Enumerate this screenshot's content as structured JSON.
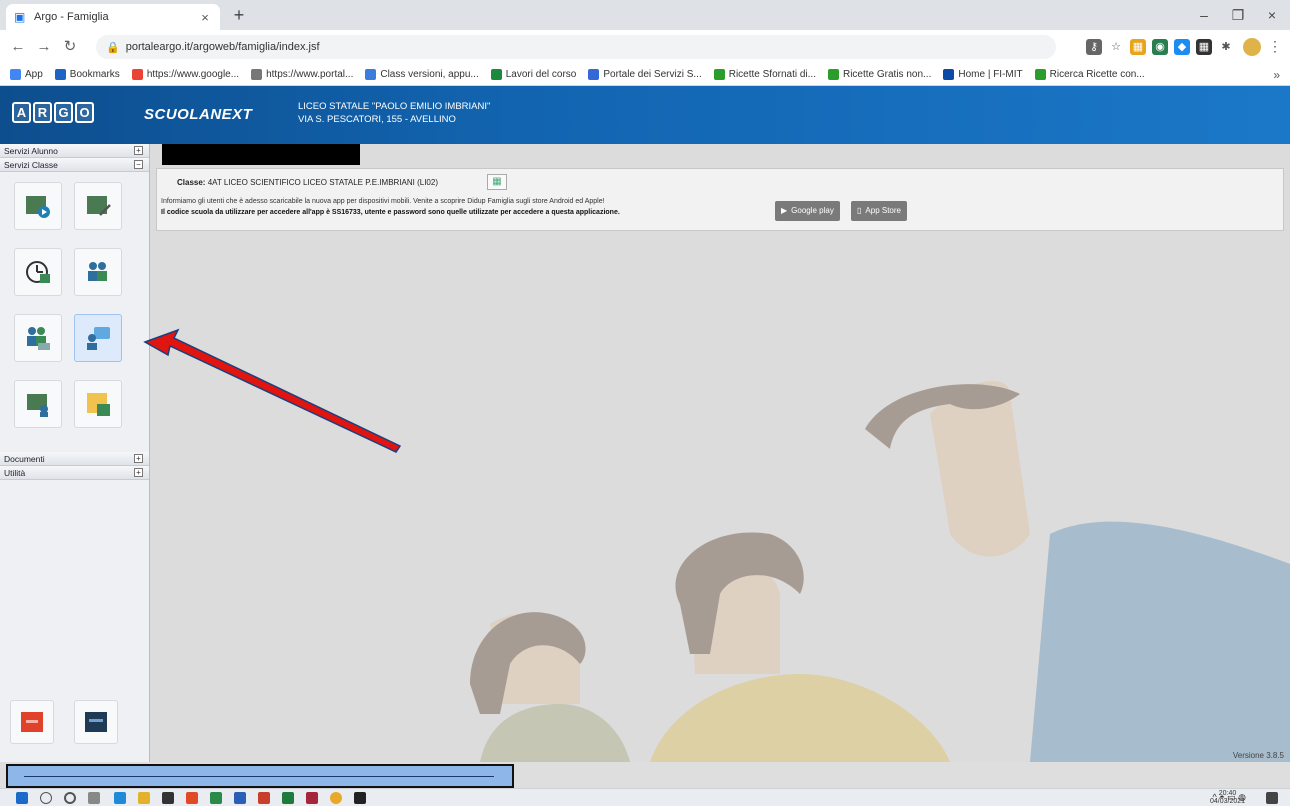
{
  "browser": {
    "tab_title": "Argo - Famiglia",
    "url": "portaleargo.it/argoweb/famiglia/index.jsf",
    "bookmarks": [
      {
        "label": "App",
        "color": "#4285f4"
      },
      {
        "label": "Bookmarks",
        "color": "#1e63c6"
      },
      {
        "label": "https://www.google...",
        "color": "#ea4335"
      },
      {
        "label": "https://www.portal...",
        "color": "#777777"
      },
      {
        "label": "Class versioni, appu...",
        "color": "#3b7ddd"
      },
      {
        "label": "Lavori del corso",
        "color": "#1b8a3e"
      },
      {
        "label": "Portale dei Servizi S...",
        "color": "#3368d6"
      },
      {
        "label": "Ricette Sfornati di...",
        "color": "#2a9d2a"
      },
      {
        "label": "Ricette Gratis non...",
        "color": "#2a9d2a"
      },
      {
        "label": "Home | FI-MIT",
        "color": "#0a4aa6"
      },
      {
        "label": "Ricerca Ricette con...",
        "color": "#2a9d2a"
      }
    ]
  },
  "header": {
    "logo_letters": [
      "A",
      "R",
      "G",
      "O"
    ],
    "brand": "SCUOLANEXT",
    "school_name": "LICEO STATALE \"PAOLO EMILIO IMBRIANI\"",
    "school_address": "VIA S. PESCATORI, 155 - AVELLINO"
  },
  "sidebar": {
    "sections": {
      "servizi_alunno": "Servizi Alunno",
      "servizi_classe": "Servizi Classe",
      "documenti": "Documenti",
      "utilita": "Utilità"
    },
    "toggle_symbol": "+"
  },
  "main": {
    "classe_label": "Classe:",
    "classe_value": "4AT LICEO SCIENTIFICO LICEO STATALE P.E.IMBRIANI (LI02)",
    "info_line1": "Informiamo gli utenti che è adesso scaricabile la nuova app per dispositivi mobili. Venite a scoprire Didup Famiglia sugli store Android ed Apple!",
    "info_line2": "Il codice scuola da utilizzare per accedere all'app è SS16733, utente e password sono quelle utilizzate per accedere a questa applicazione.",
    "google_play": "Google play",
    "app_store": "App Store",
    "version": "Versione 3.8.5"
  },
  "taskbar": {
    "time": "20:40",
    "date": "04/03/2021"
  }
}
